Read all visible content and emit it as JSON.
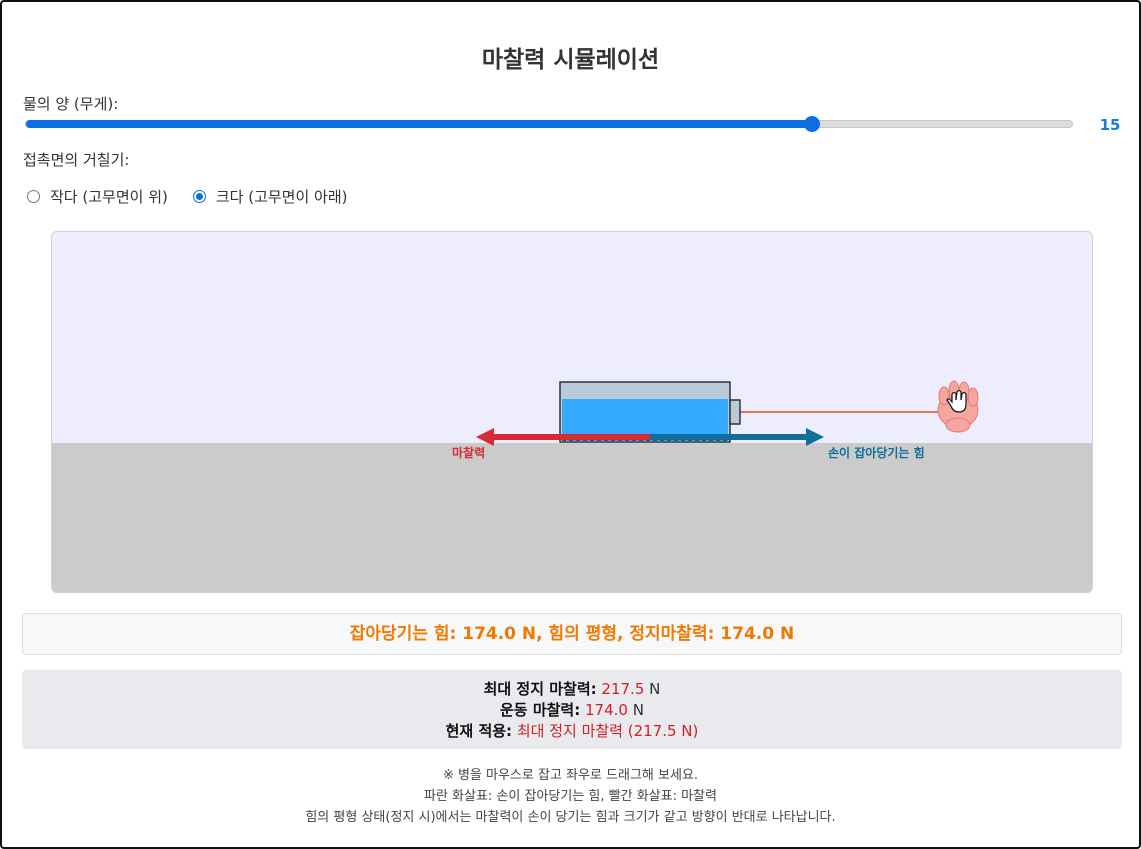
{
  "title": "마찰력 시뮬레이션",
  "weight_slider": {
    "label": "물의 양 (무게):",
    "value": 15,
    "min": 0,
    "max": 20,
    "value_display": "15"
  },
  "roughness": {
    "label": "접촉면의 거칠기:",
    "options": [
      {
        "label": "작다 (고무면이 위)",
        "checked": false
      },
      {
        "label": "크다 (고무면이 아래)",
        "checked": true
      }
    ]
  },
  "simulation": {
    "friction_label": "마찰력",
    "pull_label": "손이 잡아당기는 힘",
    "colors": {
      "sky": "#eeedfd",
      "ground": "#cbcbcb",
      "friction_arrow": "#d62a34",
      "pull_arrow": "#0f6e9a",
      "water": "#33aaff",
      "bottle": "#b9cbd9",
      "string": "#e07856",
      "hand": "#f5a6a0"
    }
  },
  "status": {
    "text": "잡아당기는 힘: 174.0 N, 힘의 평형, 정지마찰력: 174.0 N"
  },
  "info": {
    "max_static_label": "최대 정지 마찰력:",
    "max_static_value": "217.5",
    "max_static_unit": "N",
    "kinetic_label": "운동 마찰력:",
    "kinetic_value": "174.0",
    "kinetic_unit": "N",
    "current_label": "현재 적용:",
    "current_value": "최대 정지 마찰력 (217.5 N)"
  },
  "notes": [
    "※ 병을 마우스로 잡고 좌우로 드래그해 보세요.",
    "파란 화살표: 손이 잡아당기는 힘, 빨간 화살표: 마찰력",
    "힘의 평형 상태(정지 시)에서는 마찰력이 손이 당기는 힘과 크기가 같고 방향이 반대로 나타납니다."
  ]
}
